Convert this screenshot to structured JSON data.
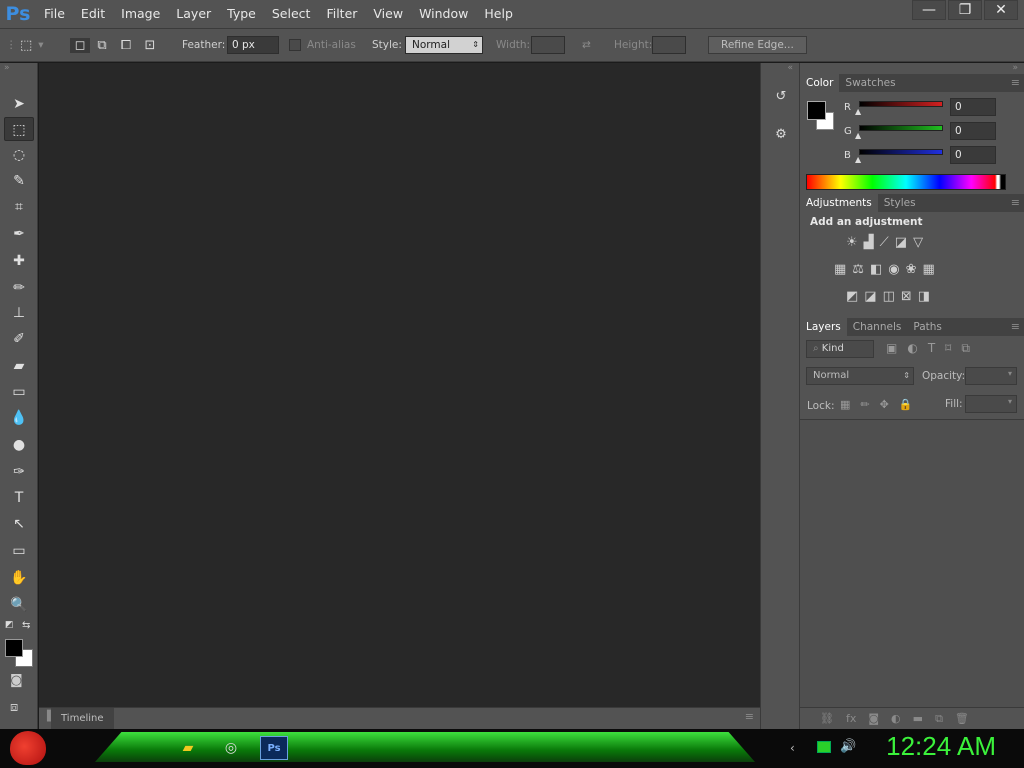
{
  "app": {
    "logo": "Ps"
  },
  "menu": [
    "File",
    "Edit",
    "Image",
    "Layer",
    "Type",
    "Select",
    "Filter",
    "View",
    "Window",
    "Help"
  ],
  "window_controls": {
    "minimize": "—",
    "restore": "❐",
    "close": "✕"
  },
  "options_bar": {
    "feather_label": "Feather:",
    "feather_value": "0 px",
    "antialias_label": "Anti-alias",
    "style_label": "Style:",
    "style_value": "Normal",
    "width_label": "Width:",
    "height_label": "Height:",
    "refine_label": "Refine Edge..."
  },
  "tools": [
    {
      "name": "move-tool",
      "glyph": "➤"
    },
    {
      "name": "rectangular-marquee-tool",
      "glyph": "⬚"
    },
    {
      "name": "lasso-tool",
      "glyph": "◌"
    },
    {
      "name": "quick-selection-tool",
      "glyph": "✎"
    },
    {
      "name": "crop-tool",
      "glyph": "⌗"
    },
    {
      "name": "eyedropper-tool",
      "glyph": "✒"
    },
    {
      "name": "healing-brush-tool",
      "glyph": "✚"
    },
    {
      "name": "brush-tool",
      "glyph": "✏"
    },
    {
      "name": "clone-stamp-tool",
      "glyph": "⊥"
    },
    {
      "name": "history-brush-tool",
      "glyph": "✐"
    },
    {
      "name": "eraser-tool",
      "glyph": "▰"
    },
    {
      "name": "gradient-tool",
      "glyph": "▭"
    },
    {
      "name": "blur-tool",
      "glyph": "💧"
    },
    {
      "name": "dodge-tool",
      "glyph": "●"
    },
    {
      "name": "pen-tool",
      "glyph": "✑"
    },
    {
      "name": "type-tool",
      "glyph": "T"
    },
    {
      "name": "path-selection-tool",
      "glyph": "↖"
    },
    {
      "name": "rectangle-tool",
      "glyph": "▭"
    },
    {
      "name": "hand-tool",
      "glyph": "✋"
    },
    {
      "name": "zoom-tool",
      "glyph": "🔍"
    }
  ],
  "timeline": {
    "label": "Timeline"
  },
  "color_panel": {
    "tabs": [
      "Color",
      "Swatches"
    ],
    "channels": [
      {
        "label": "R",
        "value": "0",
        "color": "#d42020"
      },
      {
        "label": "G",
        "value": "0",
        "color": "#20c020"
      },
      {
        "label": "B",
        "value": "0",
        "color": "#2030e0"
      }
    ]
  },
  "adjustments_panel": {
    "tabs": [
      "Adjustments",
      "Styles"
    ],
    "heading": "Add an adjustment"
  },
  "layers_panel": {
    "tabs": [
      "Layers",
      "Channels",
      "Paths"
    ],
    "kind_label": "Kind",
    "blend_mode": "Normal",
    "opacity_label": "Opacity:",
    "lock_label": "Lock:",
    "fill_label": "Fill:"
  },
  "taskbar": {
    "clock": "12:24 AM"
  }
}
